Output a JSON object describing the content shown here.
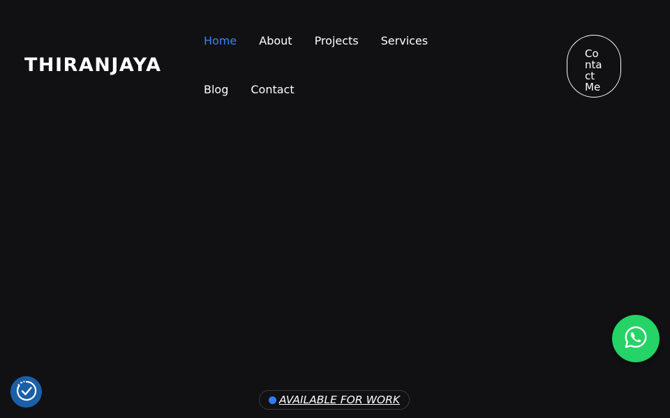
{
  "header": {
    "logo_text": "THIRANJAYA",
    "nav": {
      "items": [
        {
          "label": "Home",
          "active": true
        },
        {
          "label": "About",
          "active": false
        },
        {
          "label": "Projects",
          "active": false
        },
        {
          "label": "Services",
          "active": false
        },
        {
          "label": "Blog",
          "active": false
        },
        {
          "label": "Contact",
          "active": false
        }
      ]
    },
    "contact_button_label": "Contact Me"
  },
  "floating": {
    "whatsapp_icon": "whatsapp-icon",
    "accessibility_icon": "accessibility-icon"
  },
  "status_pill": {
    "label": "AVAILABLE FOR WORK"
  },
  "colors": {
    "background": "#111113",
    "accent": "#3b82f6",
    "whatsapp_green": "#25d366",
    "accessibility_blue": "#1b5fa8",
    "status_dot": "#2f7cf6"
  }
}
